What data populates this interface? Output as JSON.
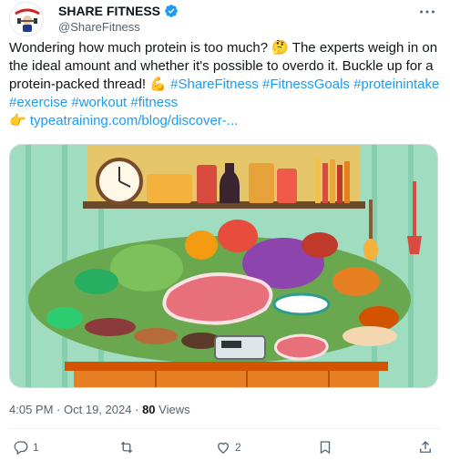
{
  "author": {
    "display_name": "SHARE FITNESS",
    "handle": "@ShareFitness",
    "avatar_icon": "share-fitness-logo",
    "verified_icon": "verified-badge-icon",
    "brand_color": "#1d9bf0"
  },
  "post": {
    "line1": "Wondering how much protein is too much?",
    "line1_emoji": "🤔",
    "line1_rest": " The experts weigh in on",
    "line2": "the ideal amount and whether it's possible to overdo it. Buckle up for a",
    "line3": "protein-packed thread!",
    "line3_emoji": "💪",
    "hashtags_line3": "#ShareFitness #FitnessGoals #proteinintake",
    "hashtags_line4": "#exercise #workout #fitness",
    "link_emoji": "👉",
    "link_text": "typeatraining.com/blog/discover-..."
  },
  "media": {
    "alt_icon": "protein-foods-illustration"
  },
  "meta": {
    "time": "4:05 PM",
    "separator": "·",
    "date": "Oct 19, 2024",
    "views_count": "80",
    "views_label": "Views"
  },
  "actions": {
    "reply_count": "1",
    "retweet_count": "",
    "like_count": "2",
    "bookmark_count": "",
    "share_count": ""
  }
}
